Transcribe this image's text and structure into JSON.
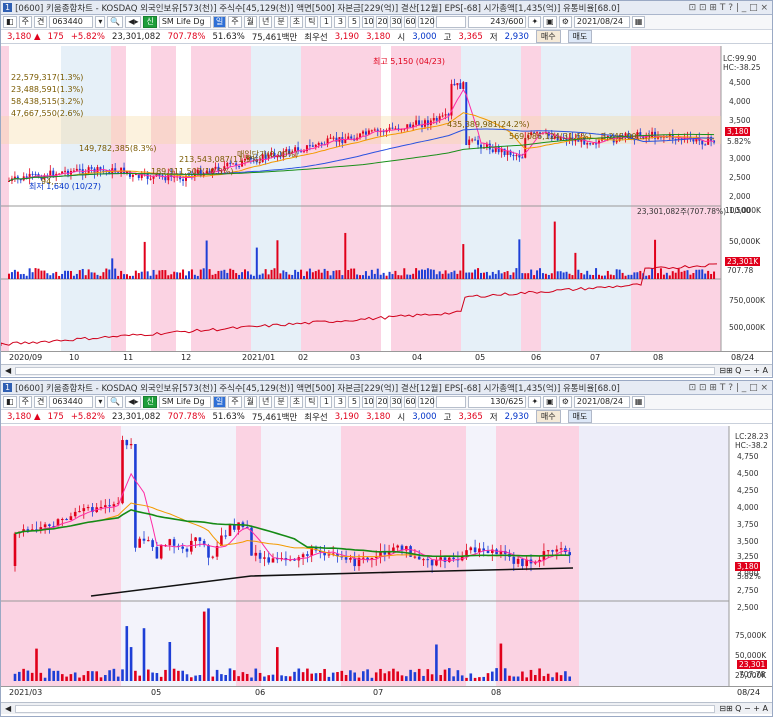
{
  "win1": {
    "number": "1",
    "title": "[0600] 키움종합차트 - KOSDAQ 외국인보유[573(천)] 주식수[45,129(천)] 액면[500] 자본금[229(억)] 결산[12월] EPS[-68] 시가총액[1,435(억)] 유통비율[68.0]",
    "controls": "⊡ ⊡ ⊞ T ? | _ □ ×",
    "toolbar": {
      "jw": "주",
      "gyeon": "견",
      "code": "063440",
      "sin": "신",
      "name": "SM Life Dg",
      "periods": [
        "일",
        "주",
        "월",
        "년",
        "분",
        "초",
        "틱"
      ],
      "nums": [
        "1",
        "3",
        "5",
        "10",
        "20",
        "30",
        "60",
        "120"
      ],
      "count": "243/600",
      "date": "2021/08/24"
    },
    "quote": {
      "price": "3,180 ▲",
      "change": "175",
      "rate": "+5.82%",
      "volume": "23,301,082",
      "vol_pct": "707.78%",
      "turnover": "51.63%",
      "amount": "75,461백만",
      "pref": "최우선",
      "ask": "3,190",
      "bid": "3,180",
      "open_lbl": "시",
      "open": "3,000",
      "high_lbl": "고",
      "high": "3,365",
      "low_lbl": "저",
      "low": "2,930",
      "buy": "매수",
      "sell": "매도"
    },
    "price_axis": [
      "4,500",
      "4,000",
      "3,500",
      "3,000",
      "2,500",
      "2,000",
      "1,500"
    ],
    "lc_label": "LC:99.90",
    "hc_label": "HC:-38.25",
    "price_tag": "3,180",
    "pct_tag": "5.82%",
    "annotations": {
      "hi": "최고 5,150 (04/23)",
      "lo": "최저 1,640 (10/27)",
      "a1": "22,579,317(1.3%)",
      "a2": "23,488,591(1.3%)",
      "a3": "58,438,515(3.2%)",
      "a4": "47,667,550(2.6%)",
      "a5": "149,782,385(8.3%)",
      "a6": "213,543,087(11.9%)",
      "a7": "189,911,507(10.5%)",
      "a8": "435,389,981(24.2%)",
      "a9": "569,086,124(31.6%)",
      "a10": "3,245.00(...)",
      "a11": "매입단가(0.00%)",
      "a12": "94,..."
    },
    "vol_header": "23,301,082주(707.78%)",
    "vol_axis": [
      "100,000K",
      "50,000K"
    ],
    "vol_tag": "23,301K",
    "vol_tag2": "707.78",
    "obv_axis": [
      "750,000K",
      "500,000K"
    ],
    "x_axis": [
      "2020/09",
      "10",
      "11",
      "12",
      "2021/01",
      "02",
      "03",
      "04",
      "05",
      "06",
      "07",
      "08",
      "08/24"
    ]
  },
  "win2": {
    "number": "1",
    "title": "[0600] 키움종합차트 - KOSDAQ 외국인보유[573(천)] 주식수[45,129(천)] 액면[500] 자본금[229(억)] 결산[12월] EPS[-68] 시가총액[1,435(억)] 유통비율[68.0]",
    "controls": "⊡ ⊡ ⊞ T ? | _ □ ×",
    "toolbar": {
      "jw": "주",
      "gyeon": "견",
      "code": "063440",
      "sin": "신",
      "name": "SM Life Dg",
      "periods": [
        "일",
        "주",
        "월",
        "년",
        "분",
        "초",
        "틱"
      ],
      "nums": [
        "1",
        "3",
        "5",
        "10",
        "20",
        "30",
        "60",
        "120"
      ],
      "count": "130/625",
      "date": "2021/08/24"
    },
    "quote": {
      "price": "3,180 ▲",
      "change": "175",
      "rate": "+5.82%",
      "volume": "23,301,082",
      "vol_pct": "707.78%",
      "turnover": "51.63%",
      "amount": "75,461백만",
      "pref": "최우선",
      "ask": "3,190",
      "bid": "3,180",
      "open_lbl": "시",
      "open": "3,000",
      "high_lbl": "고",
      "high": "3,365",
      "low_lbl": "저",
      "low": "2,930",
      "buy": "매수",
      "sell": "매도"
    },
    "price_axis": [
      "4,750",
      "4,500",
      "4,250",
      "4,000",
      "3,750",
      "3,500",
      "3,250",
      "3,000",
      "2,750",
      "2,500"
    ],
    "lc_label": "LC:28.23",
    "hc_label": "HC:-38.2",
    "price_tag": "3,180",
    "pct_tag": "5.82%",
    "vol_axis": [
      "75,000K",
      "50,000K",
      "25,000K"
    ],
    "vol_tag": "23,301",
    "vol_tag2": "707.78",
    "x_axis": [
      "2021/03",
      "05",
      "06",
      "07",
      "08",
      "08/24"
    ]
  }
}
